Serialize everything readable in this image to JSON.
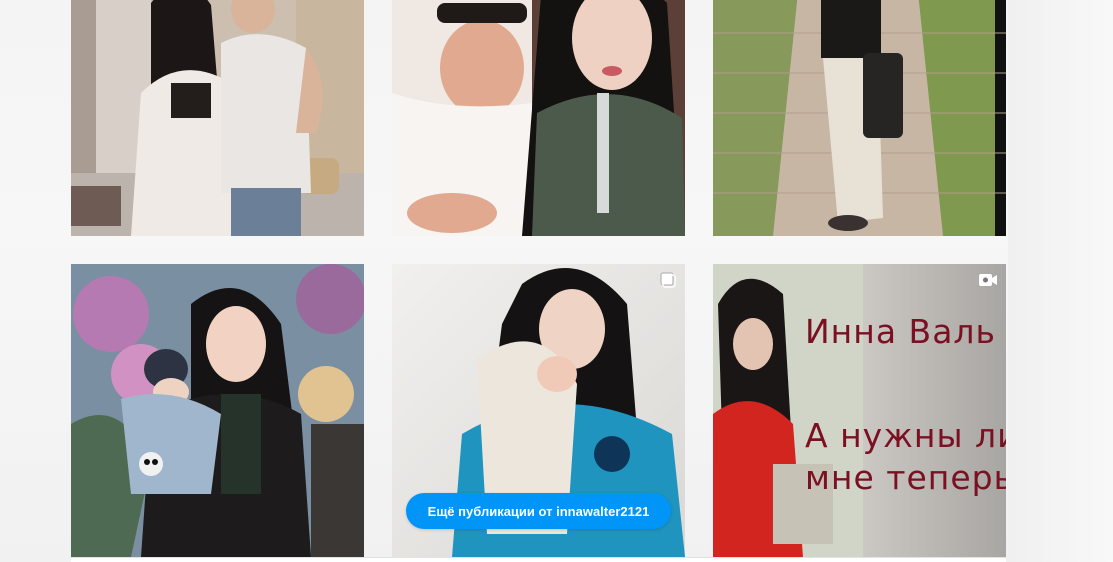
{
  "grid": {
    "posts": [
      {
        "label": "post-1",
        "type": "photo"
      },
      {
        "label": "post-2",
        "type": "photo"
      },
      {
        "label": "post-3",
        "type": "photo"
      },
      {
        "label": "post-4",
        "type": "photo"
      },
      {
        "label": "post-5",
        "type": "carousel",
        "icon": "carousel-icon"
      },
      {
        "label": "post-6",
        "type": "video",
        "icon": "video-icon",
        "overlay_lines": [
          "Инна Валь",
          "А нужны ли",
          "мне теперь"
        ]
      }
    ]
  },
  "more_button": {
    "label": "Ещё публикации от innawalter2121",
    "color": "#0095f6"
  }
}
